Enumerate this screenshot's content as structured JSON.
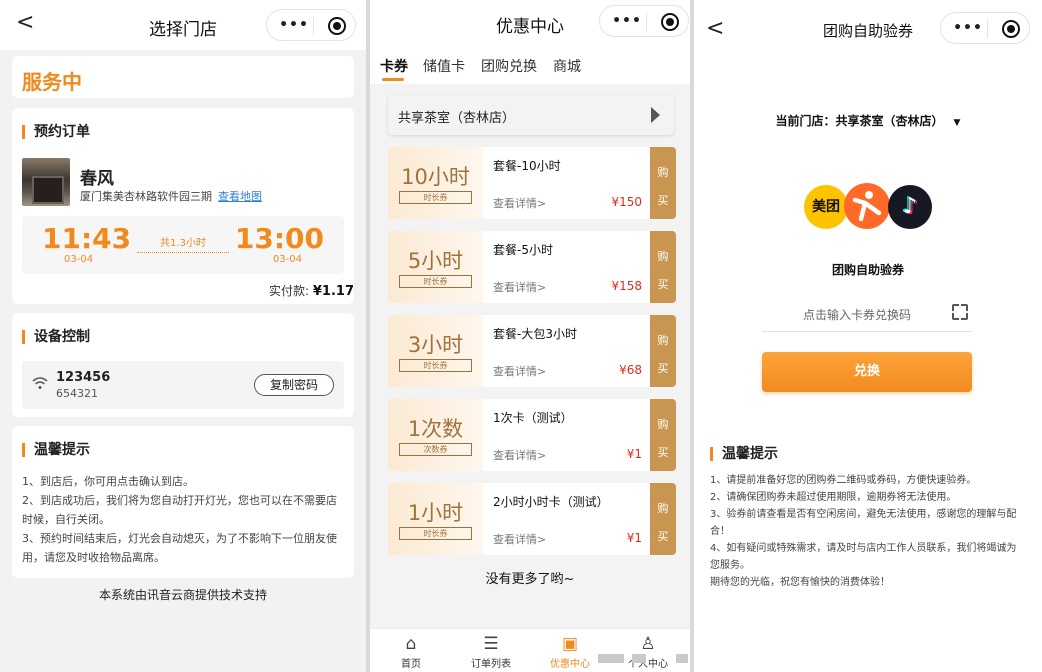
{
  "panel1": {
    "title": "选择门店",
    "back_glyph": "<",
    "menu_glyph": "•••",
    "service_status": "服务中",
    "order": {
      "section_title": "预约订单",
      "store_name": "春风",
      "address": "厦门集美杏林路软件园三期",
      "map_link": "查看地图",
      "start_time": "11:43",
      "start_date": "03-04",
      "duration": "共1.3小时",
      "end_time": "13:00",
      "end_date": "03-04",
      "paid_label": "实付款:",
      "paid_amount": "¥1.17"
    },
    "device": {
      "section_title": "设备控制",
      "wifi_name": "123456",
      "wifi_password": "654321",
      "copy_button": "复制密码"
    },
    "tips": {
      "section_title": "温馨提示",
      "lines": [
        "1、到店后，你可用点击确认到店。",
        "2、到店成功后，我们将为您自动打开灯光，您也可以在不需要店时候，自行关闭。",
        "3、预约时间结束后，灯光会自动熄灭，为了不影响下一位朋友使用，请您及时收拾物品离席。"
      ]
    },
    "footer": "本系统由讯音云商提供技术支持"
  },
  "panel2": {
    "title": "优惠中心",
    "menu_glyph": "•••",
    "tabs": [
      {
        "label": "卡券"
      },
      {
        "label": "储值卡"
      },
      {
        "label": "团购兑换"
      },
      {
        "label": "商城"
      }
    ],
    "store": "共享茶室（杏林店）",
    "coupons": [
      {
        "big": "10小时",
        "tag": "时长券",
        "name": "套餐-10小时",
        "detail": "查看详情>",
        "price": "¥150",
        "buy1": "购",
        "buy2": "买"
      },
      {
        "big": "5小时",
        "tag": "时长券",
        "name": "套餐-5小时",
        "detail": "查看详情>",
        "price": "¥158",
        "buy1": "购",
        "buy2": "买"
      },
      {
        "big": "3小时",
        "tag": "时长券",
        "name": "套餐-大包3小时",
        "detail": "查看详情>",
        "price": "¥68",
        "buy1": "购",
        "buy2": "买"
      },
      {
        "big": "1次数",
        "tag": "次数券",
        "name": "1次卡（测试）",
        "detail": "查看详情>",
        "price": "¥1",
        "buy1": "购",
        "buy2": "买"
      },
      {
        "big": "1小时",
        "tag": "时长券",
        "name": "2小时小时卡（测试）",
        "detail": "查看详情>",
        "price": "¥1",
        "buy1": "购",
        "buy2": "买"
      }
    ],
    "no_more": "没有更多了哟~",
    "tabbar": [
      {
        "label": "首页",
        "icon": "home-icon"
      },
      {
        "label": "订单列表",
        "icon": "list-icon"
      },
      {
        "label": "优惠中心",
        "icon": "ticket-icon"
      },
      {
        "label": "个人中心",
        "icon": "user-icon"
      }
    ],
    "active_color": "#f08a1c"
  },
  "panel3": {
    "title": "团购自助验券",
    "back_glyph": "<",
    "menu_glyph": "•••",
    "current_store": "当前门店：共享茶室（杏林店）",
    "caret": "▼",
    "logo_meituan": "美团",
    "group_label": "团购自助验券",
    "code_placeholder": "点击输入卡券兑换码",
    "redeem_button": "兑换",
    "tips": {
      "section_title": "温馨提示",
      "lines": [
        "1、请提前准备好您的团购券二维码或券码，方便快速验券。",
        "2、请确保团购券未超过使用期限，逾期券将无法使用。",
        "3、验券前请查看是否有空闲房间，避免无法使用，感谢您的理解与配合！",
        "4、如有疑问或特殊需求，请及时与店内工作人员联系，我们将竭诚为您服务。",
        "期待您的光临，祝您有愉快的消费体验！"
      ]
    }
  },
  "colors": {
    "accent": "#f08a1c",
    "price": "#e02b20",
    "gold": "#c89650"
  }
}
